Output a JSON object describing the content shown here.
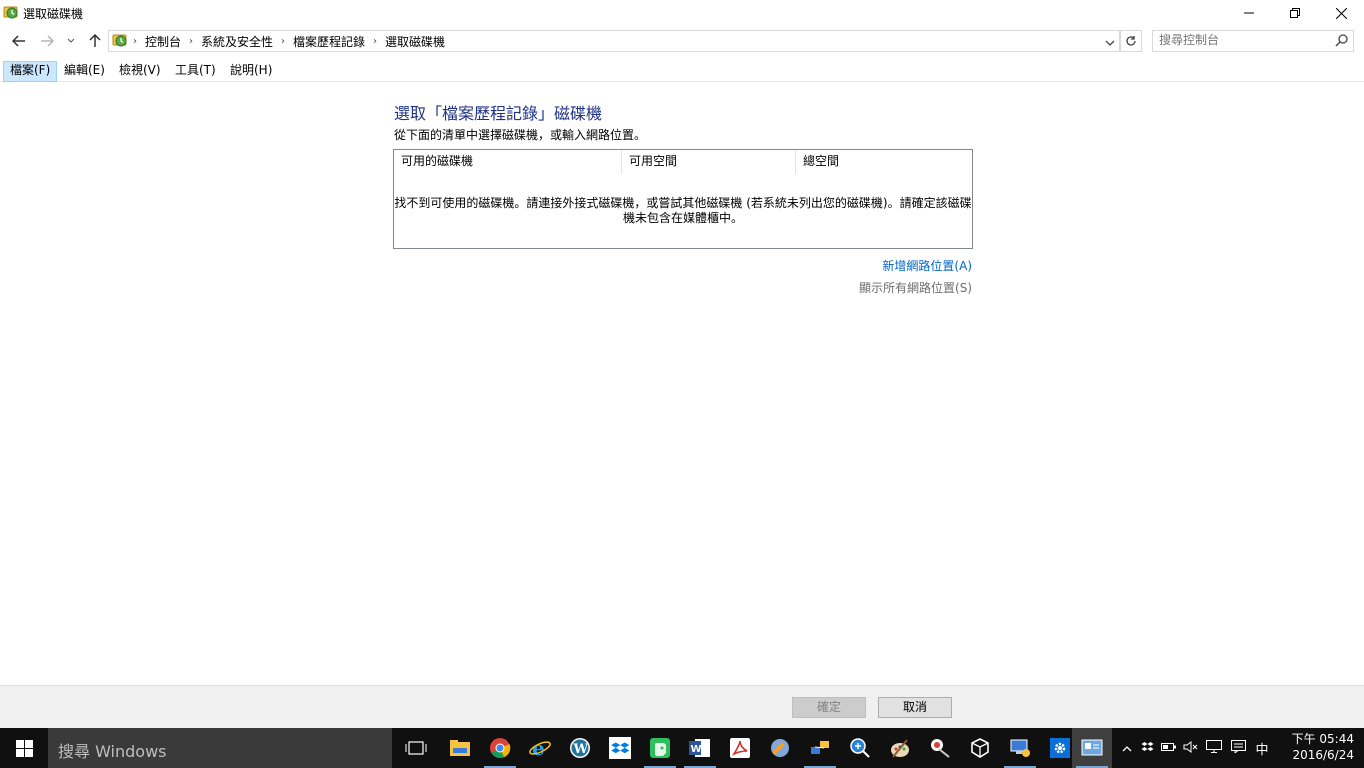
{
  "window": {
    "title": "選取磁碟機"
  },
  "address": {
    "crumbs": [
      "控制台",
      "系統及安全性",
      "檔案歷程記錄",
      "選取磁碟機"
    ]
  },
  "search": {
    "placeholder": "搜尋控制台"
  },
  "menu": [
    "檔案(F)",
    "編輯(E)",
    "檢視(V)",
    "工具(T)",
    "說明(H)"
  ],
  "main": {
    "heading": "選取「檔案歷程記錄」磁碟機",
    "subtext": "從下面的清單中選擇磁碟機，或輸入網路位置。",
    "columns": [
      "可用的磁碟機",
      "可用空間",
      "總空間"
    ],
    "empty_line1": "找不到可使用的磁碟機。請連接外接式磁碟機，或嘗試其他磁碟機 (若系統未列出您的磁碟機)。請確定該磁碟",
    "empty_line2": "機未包含在媒體櫃中。",
    "link_add": "新增網路位置(A)",
    "link_show": "顯示所有網路位置(S)"
  },
  "footer": {
    "ok": "確定",
    "cancel": "取消"
  },
  "taskbar": {
    "search_text": "搜尋 Windows",
    "ime": "中",
    "time": "下午 05:44",
    "date": "2016/6/24"
  },
  "colors": {
    "heading": "#1e3287",
    "link": "#0066cc",
    "taskbar": "#101010"
  }
}
